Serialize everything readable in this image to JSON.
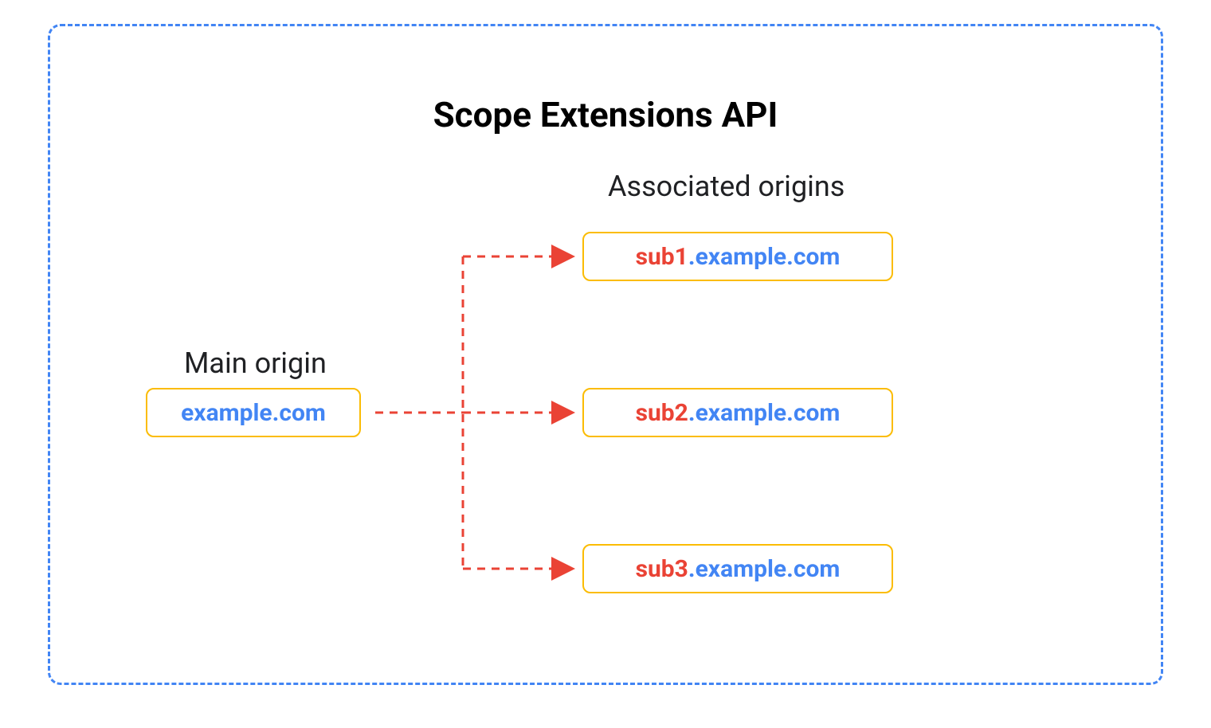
{
  "title": "Scope Extensions API",
  "mainOrigin": {
    "label": "Main origin",
    "domain": "example.com"
  },
  "associatedOrigins": {
    "label": "Associated origins",
    "items": [
      {
        "sub": "sub1",
        "domain": ".example.com"
      },
      {
        "sub": "sub2",
        "domain": ".example.com"
      },
      {
        "sub": "sub3",
        "domain": ".example.com"
      }
    ]
  },
  "colors": {
    "borderBlue": "#4285f4",
    "boxBorder": "#fbbc04",
    "textBlue": "#4285f4",
    "textRed": "#ea4335",
    "arrowRed": "#ea4335"
  }
}
